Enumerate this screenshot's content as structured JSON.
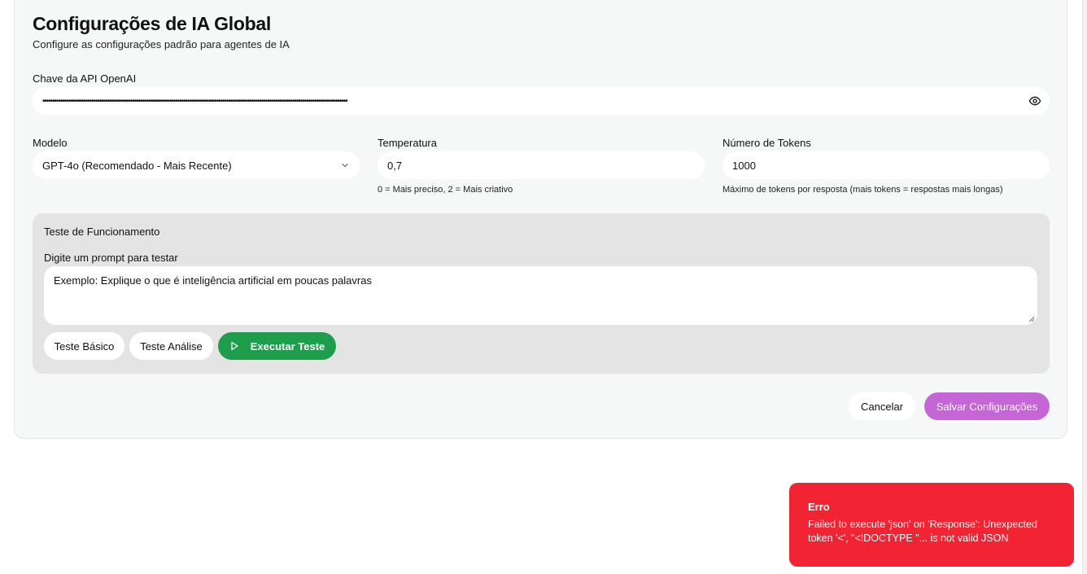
{
  "page": {
    "title": "Configurações de IA Global",
    "subtitle": "Configure as configurações padrão para agentes de IA"
  },
  "api_key": {
    "label": "Chave da API OpenAI",
    "masked_value": "••••••••••••••••••••••••••••••••••••••••••••••••••••••••••••••••••••••••••••••••••••••••••••••••••••••••••••••••••••••••••••••••••••••••••••••••••••••••••••"
  },
  "model": {
    "label": "Modelo",
    "selected": "GPT-4o (Recomendado - Mais Recente)"
  },
  "temperature": {
    "label": "Temperatura",
    "value": "0,7",
    "hint": "0 = Mais preciso, 2 = Mais criativo"
  },
  "tokens": {
    "label": "Número de Tokens",
    "value": "1000",
    "hint": "Máximo de tokens por resposta (mais tokens = respostas mais longas)"
  },
  "test": {
    "title": "Teste de Funcionamento",
    "prompt_label": "Digite um prompt para testar",
    "prompt_placeholder": "Exemplo: Explique o que é inteligência artificial em poucas palavras",
    "basic_label": "Teste Básico",
    "analysis_label": "Teste Análise",
    "run_label": "Executar Teste"
  },
  "actions": {
    "cancel_label": "Cancelar",
    "save_label": "Salvar Configurações"
  },
  "toast": {
    "title": "Erro",
    "message": "Failed to execute 'json' on 'Response': Unexpected token '<', \"<!DOCTYPE \"... is not valid JSON"
  },
  "colors": {
    "accent_green": "#1e9e4c",
    "accent_purple": "#c466d6",
    "error_red": "#f22433"
  },
  "icons": {
    "api_visibility": "eye-icon",
    "model_dropdown": "chevron-down-icon",
    "run_test": "play-icon",
    "prompt_resize": "resize-handle-icon"
  }
}
